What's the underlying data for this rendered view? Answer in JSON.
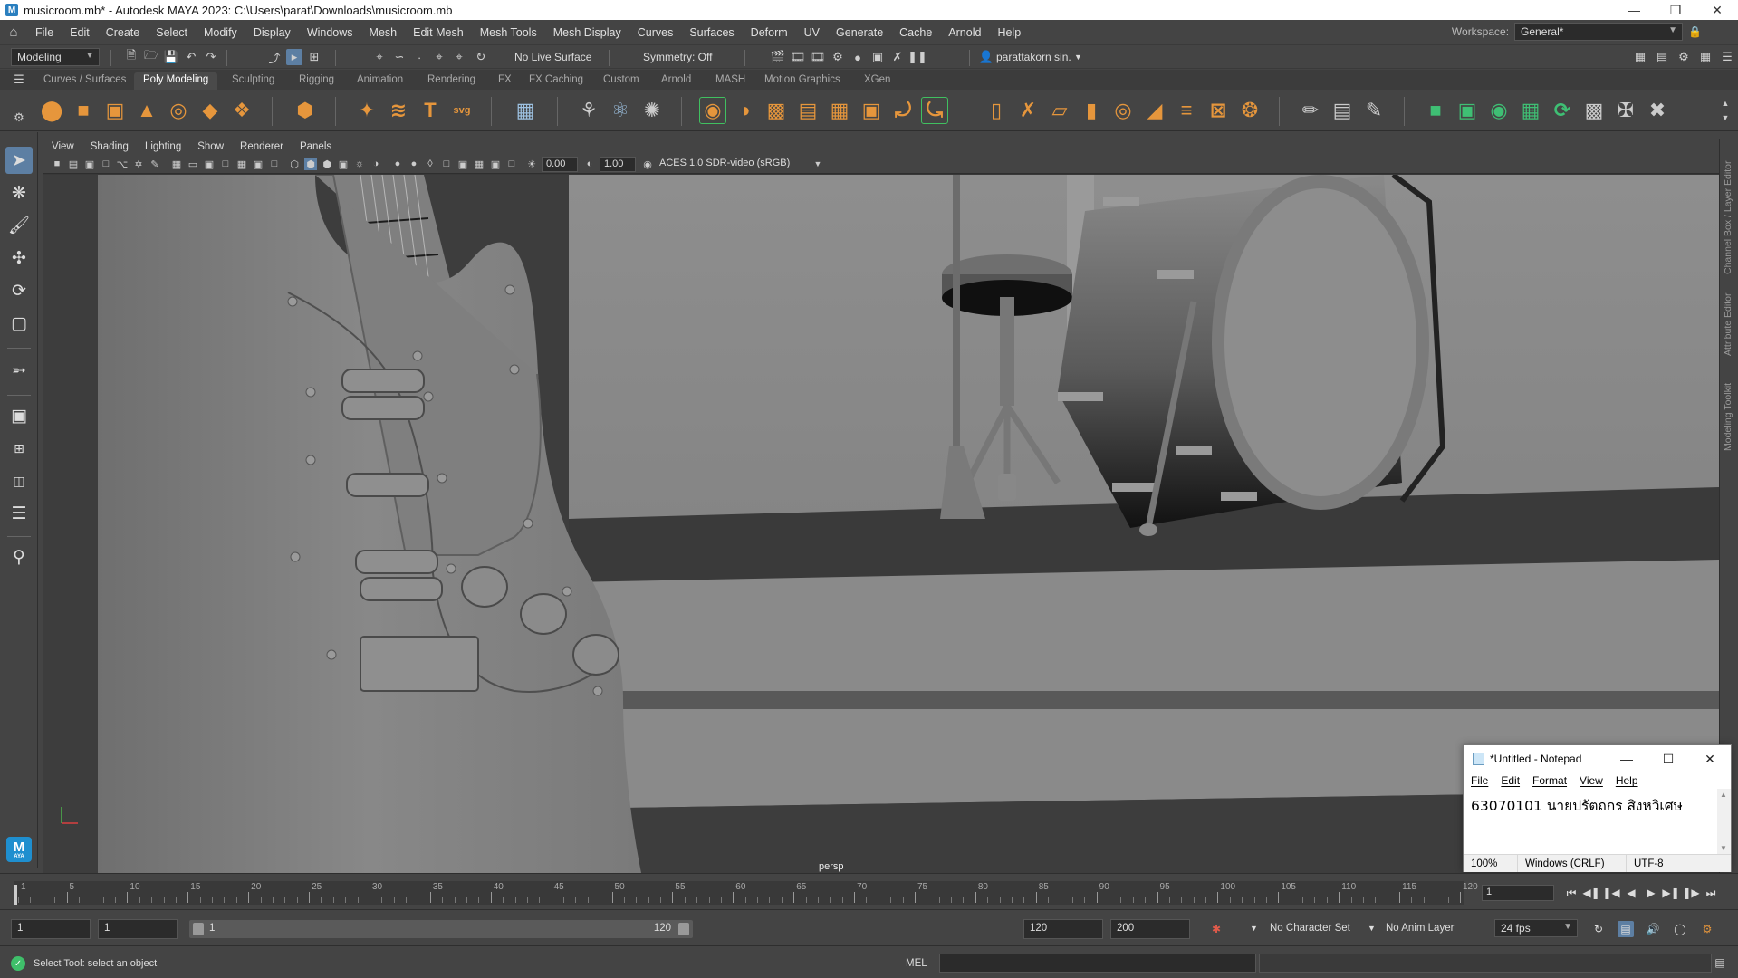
{
  "window": {
    "title": "musicroom.mb* - Autodesk MAYA 2023: C:\\Users\\parat\\Downloads\\musicroom.mb"
  },
  "menubar": {
    "items": [
      "File",
      "Edit",
      "Create",
      "Select",
      "Modify",
      "Display",
      "Windows",
      "Mesh",
      "Edit Mesh",
      "Mesh Tools",
      "Mesh Display",
      "Curves",
      "Surfaces",
      "Deform",
      "UV",
      "Generate",
      "Cache",
      "Arnold",
      "Help"
    ],
    "workspace_label": "Workspace:",
    "workspace_value": "General*"
  },
  "statusline": {
    "mode": "Modeling",
    "live_surface": "No Live Surface",
    "symmetry": "Symmetry: Off",
    "user": "parattakorn sin."
  },
  "shelf": {
    "tabs": [
      "Curves / Surfaces",
      "Poly Modeling",
      "Sculpting",
      "Rigging",
      "Animation",
      "Rendering",
      "FX",
      "FX Caching",
      "Custom",
      "Arnold",
      "MASH",
      "Motion Graphics",
      "XGen"
    ],
    "active_tab": "Poly Modeling"
  },
  "viewport": {
    "menu": [
      "View",
      "Shading",
      "Lighting",
      "Show",
      "Renderer",
      "Panels"
    ],
    "exposure": "0.00",
    "gamma": "1.00",
    "color_space": "ACES 1.0 SDR-video (sRGB)",
    "camera": "persp"
  },
  "right_tabs": [
    "Channel Box / Layer Editor",
    "Attribute Editor",
    "Modeling Toolkit"
  ],
  "notepad": {
    "title": "*Untitled - Notepad",
    "menu": [
      "File",
      "Edit",
      "Format",
      "View",
      "Help"
    ],
    "text": "63070101 นายปรัตถกร สิงหวิเศษ",
    "zoom": "100%",
    "line_ending": "Windows (CRLF)",
    "encoding": "UTF-8"
  },
  "timeslider": {
    "labels": [
      "1",
      "5",
      "10",
      "15",
      "20",
      "25",
      "30",
      "35",
      "40",
      "45",
      "50",
      "55",
      "60",
      "65",
      "70",
      "75",
      "80",
      "85",
      "90",
      "95",
      "100",
      "105",
      "110",
      "115",
      "120"
    ],
    "current_frame": "1"
  },
  "rangeslider": {
    "start_time": "1",
    "playback_start": "1",
    "range_start": "1",
    "range_end": "120",
    "playback_end": "120",
    "end_time": "200",
    "character_set": "No Character Set",
    "anim_layer": "No Anim Layer",
    "fps": "24 fps"
  },
  "helpline": {
    "text": "Select Tool: select an object",
    "command_lang": "MEL"
  }
}
